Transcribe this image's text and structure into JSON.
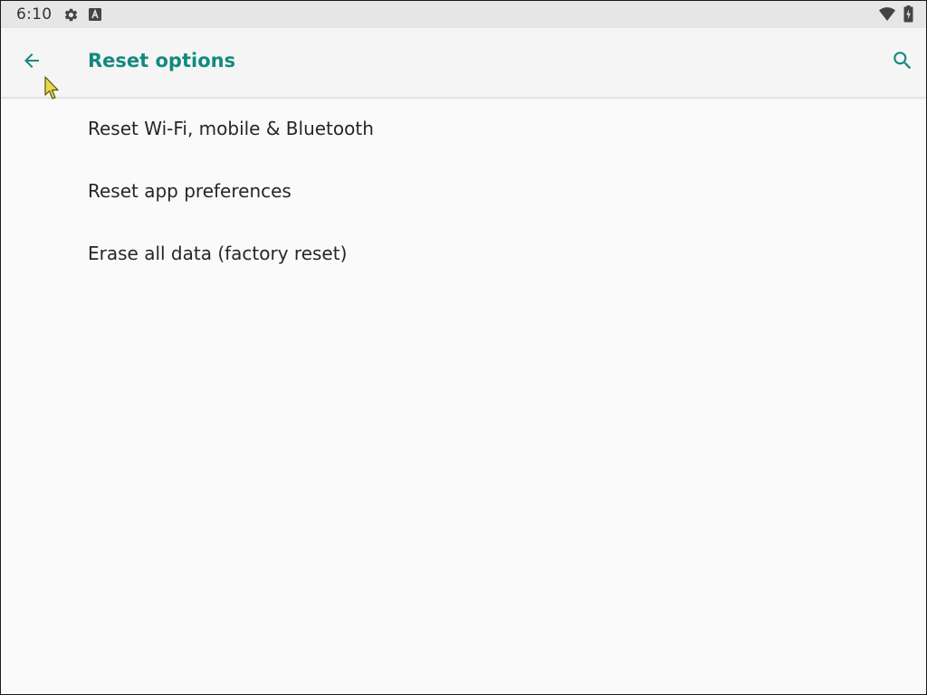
{
  "status_bar": {
    "time": "6:10",
    "icons": [
      "settings-icon",
      "a-icon",
      "wifi-icon",
      "battery-icon"
    ]
  },
  "app_bar": {
    "back_icon": "arrow-back-icon",
    "title": "Reset options",
    "search_icon": "search-icon"
  },
  "options": [
    {
      "label": "Reset Wi-Fi, mobile & Bluetooth"
    },
    {
      "label": "Reset app preferences"
    },
    {
      "label": "Erase all data (factory reset)"
    }
  ],
  "colors": {
    "accent": "#138a7e",
    "status_bar_bg": "#e6e6e6",
    "app_bar_bg": "#f5f5f5",
    "background": "#fafafa",
    "text_primary": "#262626"
  }
}
